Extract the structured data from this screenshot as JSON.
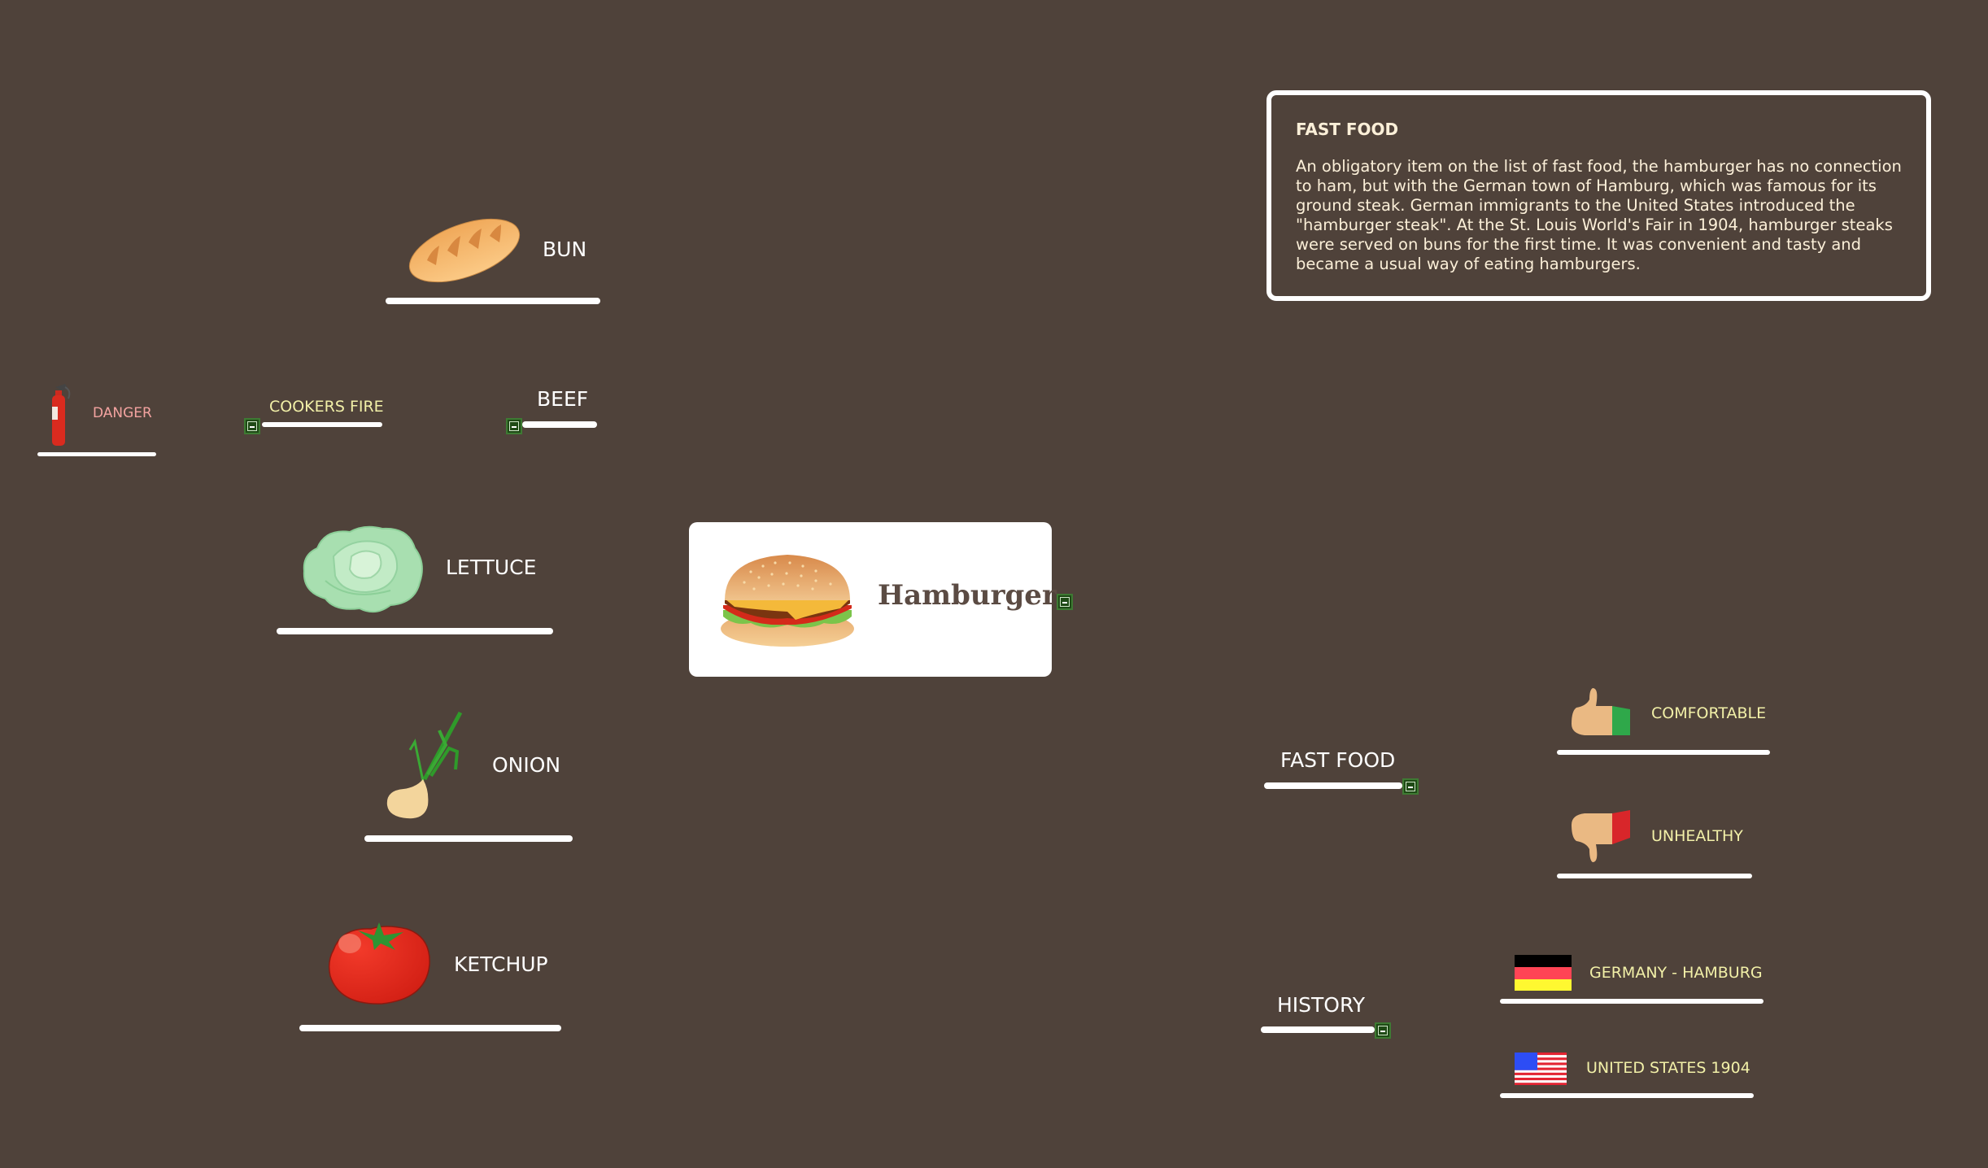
{
  "colors": {
    "background": "#4f423a",
    "connector": "#ffffff",
    "toggle": "#1f4a16",
    "label_primary": "#ffffff",
    "label_secondary": "#f2f0a8",
    "label_danger": "#f3a3a0"
  },
  "central_topic": {
    "title": "Hamburger",
    "icon": "hamburger-icon",
    "toggle": "collapse"
  },
  "info_note": {
    "title": "FAST FOOD",
    "body": "An obligatory item on the list of fast food, the hamburger has no connection to ham, but with the German town of Hamburg, which was famous for its ground steak. German immigrants to the United States introduced the \"hamburger steak\". At the St. Louis World's Fair in 1904, hamburger steaks were served on buns for the first time. It was convenient and tasty and became a usual way of eating hamburgers."
  },
  "left_branches": [
    {
      "label": "BUN",
      "icon": "bread-icon"
    },
    {
      "label": "BEEF",
      "toggle": "collapse",
      "children": [
        {
          "label": "COOKERS FIRE",
          "toggle": "collapse",
          "children": [
            {
              "label": "DANGER",
              "icon": "fire-extinguisher-icon"
            }
          ]
        }
      ]
    },
    {
      "label": "LETTUCE",
      "icon": "lettuce-icon"
    },
    {
      "label": "ONION",
      "icon": "onion-icon"
    },
    {
      "label": "KETCHUP",
      "icon": "tomato-icon"
    }
  ],
  "right_branches": [
    {
      "label": "FAST FOOD",
      "toggle": "collapse",
      "children": [
        {
          "label": "COMFORTABLE",
          "icon": "thumbs-up-icon"
        },
        {
          "label": "UNHEALTHY",
          "icon": "thumbs-down-icon"
        }
      ]
    },
    {
      "label": "HISTORY",
      "toggle": "collapse",
      "children": [
        {
          "label": "GERMANY - HAMBURG",
          "icon": "germany-flag-icon"
        },
        {
          "label": "UNITED STATES 1904",
          "icon": "us-flag-icon"
        }
      ]
    }
  ]
}
